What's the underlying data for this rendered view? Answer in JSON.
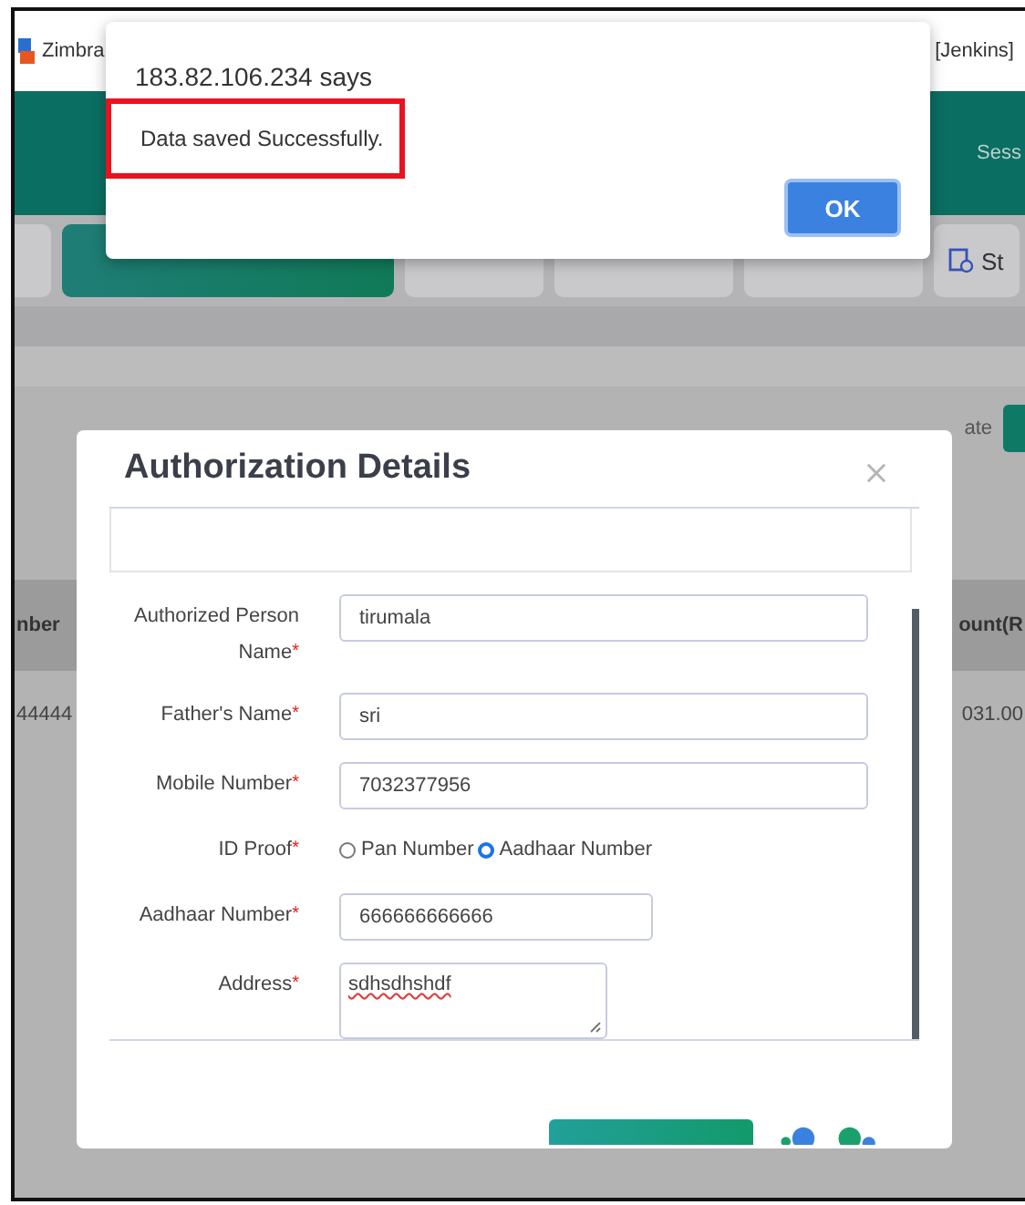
{
  "browser": {
    "tab_left": "Zimbra",
    "tab_right": "[Jenkins]"
  },
  "header": {
    "session": "Sess"
  },
  "nav_items": [
    {
      "selected": false
    },
    {
      "selected": true
    },
    {
      "selected": false
    },
    {
      "selected": false
    },
    {
      "selected": false
    },
    {
      "label": "St",
      "selected": false
    }
  ],
  "page": {
    "action_label": "ate",
    "table": {
      "columns": [
        "nber",
        "ount(R"
      ],
      "rows": [
        [
          "44444",
          "031.00"
        ]
      ]
    }
  },
  "modal": {
    "title": "Authorization Details",
    "fields": [
      {
        "kind": "text",
        "label": "Authorized Person Name",
        "mark": "*",
        "value": "tirumala"
      },
      {
        "kind": "text",
        "label": "Father's Name",
        "mark": "*",
        "value": "sri"
      },
      {
        "kind": "text",
        "label": "Mobile Number",
        "mark": "*",
        "value": "7032377956"
      },
      {
        "kind": "radio",
        "label": "ID Proof",
        "mark": "*",
        "options": [
          {
            "label": "Pan Number",
            "selected": false
          },
          {
            "label": "Aadhaar Number",
            "selected": true
          }
        ]
      },
      {
        "kind": "short",
        "label": "Aadhaar Number",
        "mark": "*",
        "value": "666666666666"
      },
      {
        "kind": "textarea",
        "label": "Address",
        "mark": "*",
        "value": "sdhsdhshdf"
      }
    ]
  },
  "alert": {
    "title": "183.82.106.234 says",
    "message": "Data saved Successfully.",
    "highlighted": true,
    "button": "OK"
  }
}
